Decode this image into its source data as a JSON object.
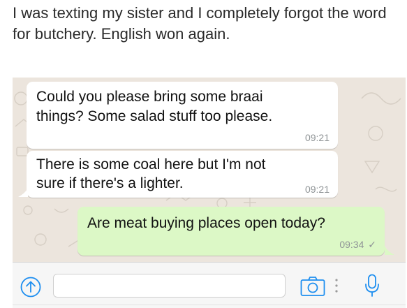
{
  "post": {
    "caption": "I was texting my sister and I completely forgot the word for butchery. English won again."
  },
  "messages": [
    {
      "direction": "incoming",
      "lines": [
        "Could you please bring some braai",
        "things? Some salad stuff too please."
      ],
      "time": "09:21"
    },
    {
      "direction": "incoming",
      "lines": [
        "There is some coal here but I'm not",
        "sure if there's a lighter."
      ],
      "time": "09:21"
    },
    {
      "direction": "outgoing",
      "lines": [
        "Are meat buying places open today?"
      ],
      "time": "09:34",
      "status": "✓"
    }
  ],
  "composer": {
    "input_value": "",
    "icons": [
      "upload-arrow-icon",
      "camera-icon",
      "more-dots-icon",
      "microphone-icon"
    ]
  },
  "colors": {
    "chat_background": "#ece5dd",
    "incoming_bubble": "#ffffff",
    "outgoing_bubble": "#dcf8c6",
    "accent_blue": "#1d8ef0",
    "timestamp": "#8f9496"
  }
}
